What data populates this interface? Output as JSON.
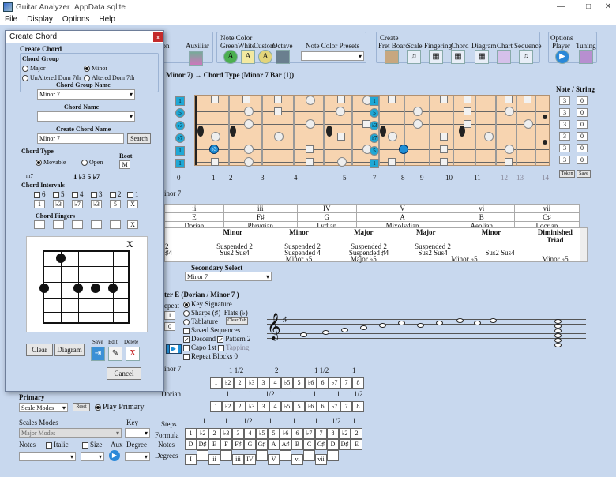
{
  "window": {
    "title": "Guitar Analyzer",
    "file": "AppData.sqlite"
  },
  "menu": [
    "File",
    "Display",
    "Options",
    "Help"
  ],
  "toolbar": {
    "auxiliar": "Auxiliar",
    "note_color": "Note Color",
    "note_color_items": [
      "Green",
      "White",
      "Custom",
      "Octave"
    ],
    "note_color_presets": "Note Color Presets",
    "create": "Create",
    "create_items": [
      "Fret Board",
      "Scale",
      "Fingering",
      "Chord",
      "Diagram",
      "Chart",
      "Sequence"
    ],
    "options": "Options",
    "option_items": [
      "Player",
      "Tuning"
    ],
    "partial_left": "ion"
  },
  "header": {
    "path_title": "Minor 7) → Chord Type  (Minor 7 Bar (1))"
  },
  "fretboard": {
    "fret_numbers": [
      "0",
      "1",
      "2",
      "3",
      "4",
      "5",
      "7",
      "8",
      "9",
      "10",
      "11",
      "12",
      "13",
      "14"
    ],
    "left_labels": [
      "1",
      "5",
      "♭3",
      "♭7",
      "1",
      "1"
    ],
    "mid_labels": [
      "1",
      "5",
      "♭3",
      "♭7",
      "5",
      "1"
    ],
    "marker_note": "♭3"
  },
  "note_string": {
    "title": "Note / String",
    "rows": [
      [
        "3",
        "0"
      ],
      [
        "3",
        "0"
      ],
      [
        "3",
        "0"
      ],
      [
        "3",
        "0"
      ],
      [
        "3",
        "0"
      ],
      [
        "3",
        "0"
      ]
    ],
    "token": "Token",
    "save": "Save"
  },
  "modes": {
    "label_partial": "inor 7",
    "numerals": [
      "ii",
      "iii",
      "IV",
      "V",
      "vi",
      "vii"
    ],
    "notes": [
      "E",
      "F♯",
      "G",
      "A",
      "B",
      "C♯"
    ],
    "mode_names": [
      "Dorian",
      "Phrygian",
      "Lydian",
      "Mixolydian",
      "Aeolian",
      "Locrian"
    ],
    "chord_types": [
      "Minor",
      "Minor",
      "Major",
      "Major",
      "Minor",
      "Diminished Triad"
    ],
    "row2": [
      "Suspended 2",
      "Suspended 2",
      "Suspended 2",
      "Suspended 2",
      "",
      ""
    ],
    "row3": [
      "Sus2 Sus4",
      "Suspended 4",
      "Suspended ♯4",
      "Sus2 Sus4",
      "Sus2 Sus4",
      ""
    ],
    "row4": [
      "",
      "Minor ♭5",
      "Major ♭5",
      "",
      "Minor ♭5",
      "Minor ♭5"
    ],
    "row1_partial": "2",
    "row2_partial": "♯4"
  },
  "secondary": {
    "label": "Secondary Select",
    "value": "Minor 7"
  },
  "notation": {
    "header": "ter E (Dorian / Minor 7 )",
    "repeat": "epeat",
    "key_signature": "Key Signature",
    "sharps": "Sharps (♯)",
    "flats": "Flats (♭)",
    "tablature": "Tablature",
    "clear_tab": "Clear Tab",
    "saved_sequences": "Saved Sequences",
    "descend": "Descend",
    "pattern2": "Pattern 2",
    "capo": "Capo 1st",
    "tapping": "Tapping",
    "repeat_blocks": "Repeat Blocks",
    "repeat_blocks_val": "0",
    "repeat_num": "1",
    "repeat_num2": "0"
  },
  "intervals": {
    "minor7": "inor 7",
    "dorian": "Dorian",
    "steps1": [
      "1 1/2",
      "2",
      "1 1/2",
      "1"
    ],
    "row1": [
      "1",
      "♭2",
      "2",
      "♭3",
      "3",
      "4",
      "♭5",
      "5",
      "♭6",
      "6",
      "♭7",
      "7",
      "8"
    ],
    "steps2": [
      "1",
      "1",
      "1/2",
      "1",
      "1",
      "1",
      "1/2"
    ],
    "row2": [
      "1",
      "♭2",
      "2",
      "♭3",
      "3",
      "4",
      "♭5",
      "5",
      "♭6",
      "6",
      "♭7",
      "7",
      "8"
    ],
    "steps3": [
      "1",
      "1",
      "1/2",
      "1",
      "1",
      "1",
      "1/2",
      "1"
    ],
    "formula": [
      "1",
      "♭2",
      "2",
      "♭3",
      "3",
      "4",
      "♭5",
      "5",
      "♭6",
      "6",
      "♭7",
      "7",
      "8",
      "♭2",
      "2"
    ],
    "notes": [
      "D",
      "D♯",
      "E",
      "F",
      "F♯",
      "G",
      "G♯",
      "A",
      "A♯",
      "B",
      "C",
      "C♯",
      "D",
      "D♯",
      "E"
    ],
    "degrees": [
      "I",
      "",
      "ii",
      "",
      "iii",
      "IV",
      "",
      "V",
      "",
      "vi",
      "",
      "vii",
      ""
    ],
    "steps_label": "Steps",
    "formula_label": "Formula",
    "notes_label": "Notes",
    "degrees_label": "Degrees"
  },
  "bottom": {
    "primary": "Primary",
    "scale_modes": "Scale Modes",
    "reset": "Reset",
    "play_primary": "Play Primary",
    "scales_modes": "Scales Modes",
    "major_modes": "Major Modes",
    "key": "Key",
    "notes": "Notes",
    "italic": "Italic",
    "size": "Size",
    "aux": "Aux",
    "degree": "Degree"
  },
  "dialog": {
    "title": "Create Chord",
    "heading": "Create Chord",
    "chord_group": "Chord Group",
    "major": "Major",
    "minor": "Minor",
    "unaltered": "UnAltered Dom 7th",
    "altered": "Altered Dom 7th",
    "chord_group_name": "Chord Group Name",
    "chord_group_value": "Minor 7",
    "chord_name": "Chord Name",
    "chord_name_value": "",
    "create_chord_name": "Create Chord Name",
    "create_value": "Minor 7",
    "search": "Search",
    "chord_type": "Chord Type",
    "root": "Root",
    "movable": "Movable",
    "open": "Open",
    "root_value": "M",
    "m7": "m7",
    "formula": "1 ♭3 5 ♭7",
    "chord_intervals": "Chord Intervals",
    "interval_labels": [
      "6",
      "5",
      "4",
      "3",
      "2",
      "1"
    ],
    "interval_values": [
      "1",
      "♭3",
      "♭7",
      "♭3",
      "5",
      "X"
    ],
    "chord_fingers": "Chord Fingers",
    "finger_x": "X",
    "diagram_x": "X",
    "clear": "Clear",
    "diagram": "Diagram",
    "save": "Save",
    "edit": "Edit",
    "delete": "Delete",
    "cancel": "Cancel"
  },
  "colors": {
    "accent": "#1f8fd6",
    "fret_bg": "#f7d4b0",
    "panel": "#c8d8ee"
  }
}
